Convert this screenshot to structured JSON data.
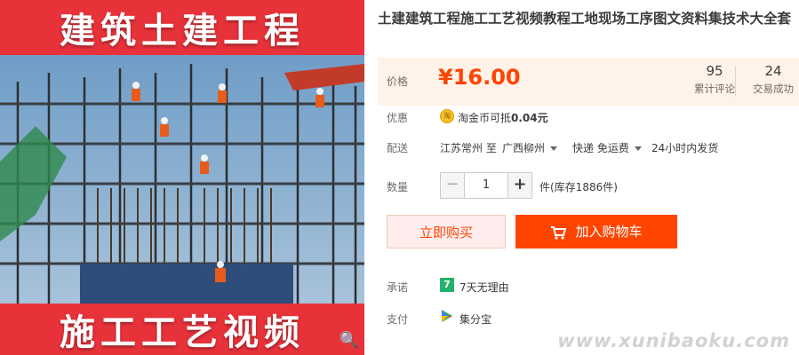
{
  "image": {
    "top_banner": "建筑土建工程",
    "bottom_banner": "施工工艺视频"
  },
  "product": {
    "title": "土建建筑工程施工工艺视频教程工地现场工序图文资料集技术大全套"
  },
  "price": {
    "label": "价格",
    "value": "¥16.00",
    "reviews_count": "95",
    "reviews_label": "累计评论",
    "trades_count": "24",
    "trades_label": "交易成功"
  },
  "discount": {
    "label": "优惠",
    "coin_icon_text": "淘",
    "text_prefix": "淘金币可抵",
    "amount": "0.04元"
  },
  "shipping": {
    "label": "配送",
    "from": "江苏常州 至",
    "to": "广西柳州",
    "method": "快递 免运费",
    "dispatch": "24小时内发货"
  },
  "quantity": {
    "label": "数量",
    "minus": "−",
    "value": "1",
    "plus": "+",
    "stock": "件(库存1886件)"
  },
  "actions": {
    "buy_now": "立即购买",
    "add_to_cart": "加入购物车"
  },
  "promise": {
    "label": "承诺",
    "icon_text": "7",
    "text": "7天无理由"
  },
  "payment": {
    "label": "支付",
    "text": "集分宝"
  },
  "watermark": "www.xunibaoku.com",
  "colors": {
    "accent": "#ff4400",
    "price_bg": "#fff2e8",
    "banner_red": "#e8323a"
  }
}
